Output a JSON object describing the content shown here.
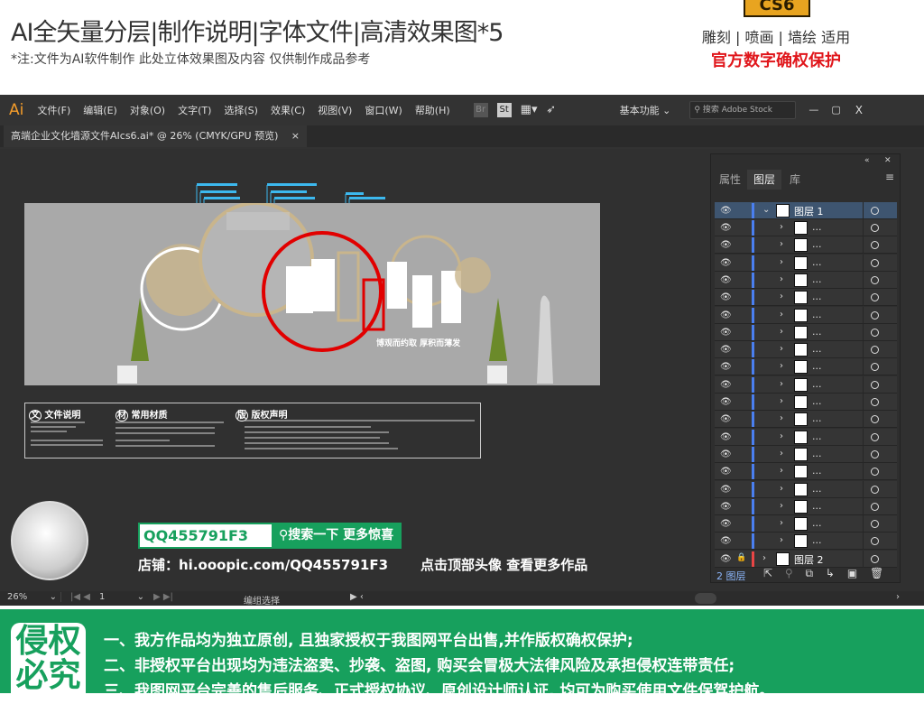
{
  "banner": {
    "title": "AI全矢量分层|制作说明|字体文件|高清效果图*5",
    "subtitle": "*注:文件为AI软件制作 此处立体效果图及内容 仅供制作成品参考",
    "version_badge": "CS6",
    "uses": "雕刻 | 喷画 | 墙绘 适用",
    "protection": "官方数字确权保护"
  },
  "app": {
    "logo": "Ai",
    "menu": [
      "文件(F)",
      "编辑(E)",
      "对象(O)",
      "文字(T)",
      "选择(S)",
      "效果(C)",
      "视图(V)",
      "窗口(W)",
      "帮助(H)"
    ],
    "toolbar_icons": {
      "bridge": "Br",
      "stock": "St"
    },
    "workspace": "基本功能",
    "search_placeholder": "搜索 Adobe Stock",
    "window_controls": {
      "minimize": "—",
      "maximize": "▢",
      "close": "X"
    },
    "doc_tab": "高端企业文化墙源文件AIcs6.ai* @ 26% (CMYK/GPU 预览)",
    "doc_tab_close": "×"
  },
  "artwork": {
    "slogan": "博观而约取 厚积而薄发",
    "info_sections": [
      {
        "icon": "文",
        "title": "文件说明"
      },
      {
        "icon": "材",
        "title": "常用材质"
      },
      {
        "icon": "版",
        "title": "版权声明"
      }
    ]
  },
  "promo": {
    "search_value": "QQ455791F3",
    "search_button": "搜索一下 更多惊喜",
    "shop": "店铺：hi.ooopic.com/QQ455791F3",
    "hint": "点击顶部头像 查看更多作品"
  },
  "layers_panel": {
    "tabs": [
      "属性",
      "图层",
      "库"
    ],
    "active_tab": "图层",
    "layer1": "图层 1",
    "layer2": "图层 2",
    "sublayer_label": "...",
    "sublayer_count": 19,
    "footer_count": "2 图层"
  },
  "status": {
    "zoom": "26%",
    "artboard": "1",
    "tool": "编组选择"
  },
  "footer": {
    "badge": "侵权必究",
    "lines": [
      "一、我方作品均为独立原创, 且独家授权于我图网平台出售,并作版权确权保护;",
      "二、非授权平台出现均为违法盗卖、抄袭、盗图, 购买会冒极大法律风险及承担侵权连带责任;",
      "三、我图网平台完善的售后服务、正式授权协议、原创设计师认证, 均可为购买使用文件保驾护航。"
    ]
  },
  "colors": {
    "accent_green": "#17a05d",
    "ai_orange": "#f39c2b",
    "protect_red": "#e0161b",
    "layer_blue": "#4a7ff0",
    "layer_red": "#e84545"
  }
}
